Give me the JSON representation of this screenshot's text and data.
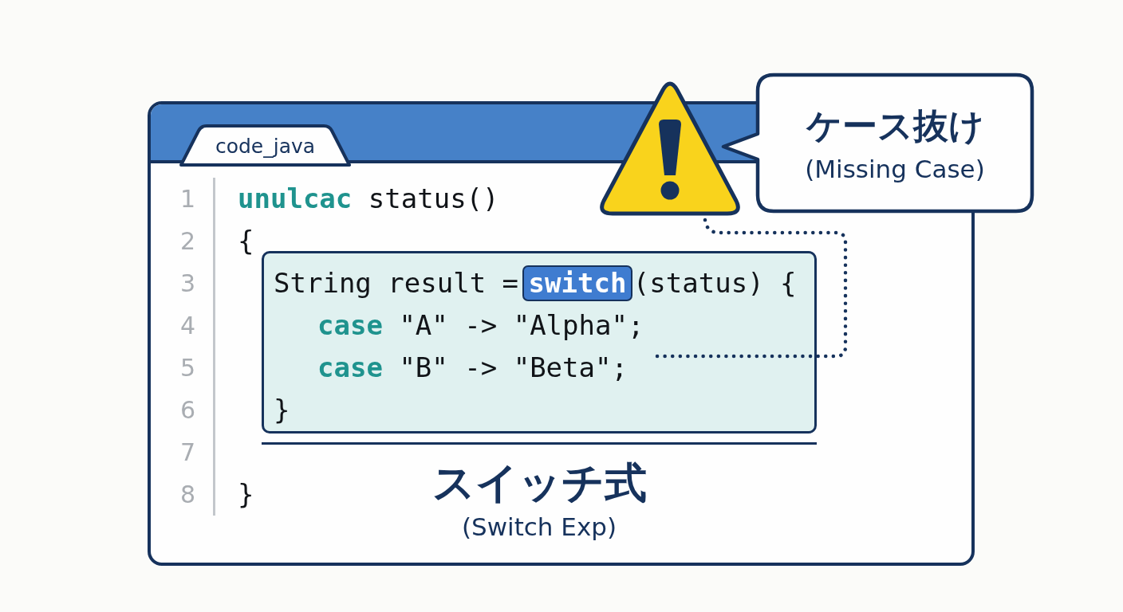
{
  "editor": {
    "tab": {
      "label": "code_java",
      "selected": true
    },
    "line_numbers": [
      "1",
      "2",
      "3",
      "4",
      "5",
      "6",
      "7",
      "8"
    ],
    "lines_before": [
      {
        "tokens": [
          {
            "kind": "keyword",
            "text": "unulcac"
          },
          {
            "kind": "plain",
            "text": "status()"
          }
        ]
      },
      {
        "tokens": [
          {
            "kind": "plain",
            "text": "{"
          }
        ]
      }
    ],
    "switch_block": {
      "lines": [
        {
          "tokens": [
            {
              "kind": "plain",
              "text": "String result ="
            },
            {
              "kind": "highlight",
              "text": "switch"
            },
            {
              "kind": "plain",
              "text": "(status) {"
            }
          ],
          "children": [
            {
              "tokens": [
                {
                  "kind": "keyword",
                  "text": "case"
                },
                {
                  "kind": "plain",
                  "text": "\"A\" -> \"Alpha\";"
                }
              ]
            },
            {
              "tokens": [
                {
                  "kind": "keyword",
                  "text": "case"
                },
                {
                  "kind": "plain",
                  "text": "\"B\" -> \"Beta\";"
                }
              ]
            }
          ]
        },
        {
          "tokens": [
            {
              "kind": "plain",
              "text": "}"
            }
          ]
        }
      ],
      "caption": {
        "title": "スイッチ式",
        "subtitle": "(Switch Exp)"
      }
    },
    "lines_after": [
      {
        "tokens": [
          {
            "kind": "plain",
            "text": "}"
          }
        ]
      }
    ]
  },
  "warning_callout": {
    "title": "ケース抜け",
    "subtitle": "(Missing Case)"
  }
}
